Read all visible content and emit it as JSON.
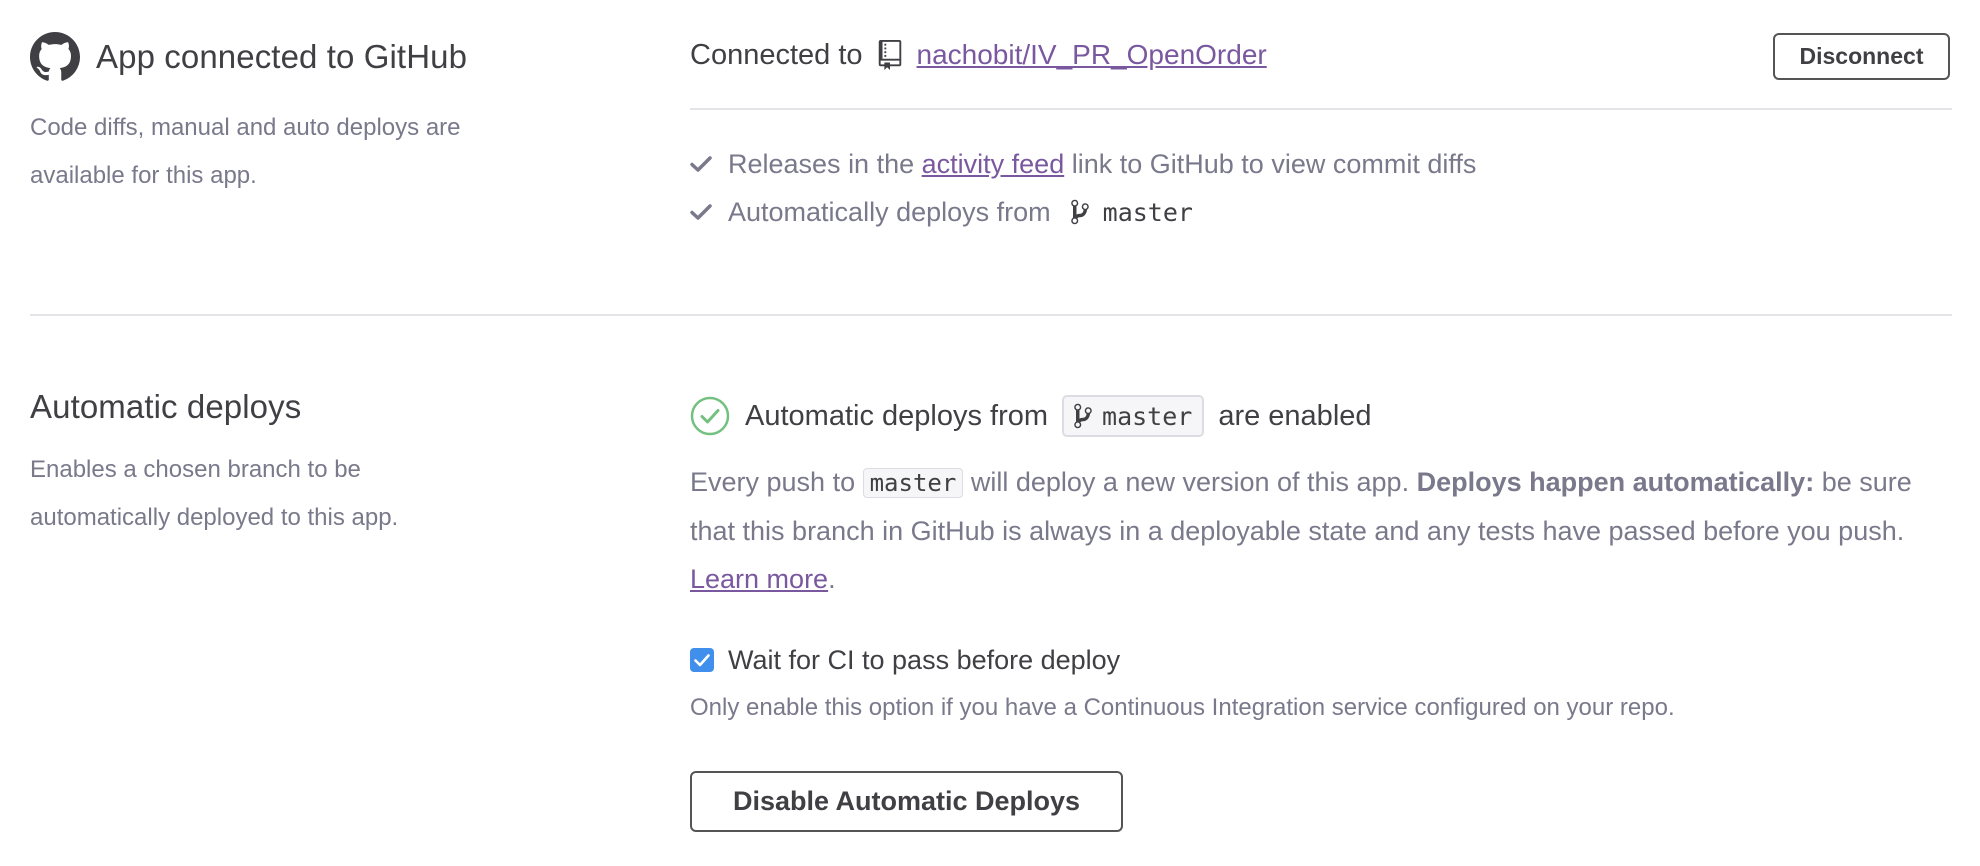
{
  "github": {
    "title": "App connected to GitHub",
    "description": "Code diffs, manual and auto deploys are available for this app.",
    "connected_label": "Connected to",
    "repo_name": "nachobit/IV_PR_OpenOrder",
    "disconnect_label": "Disconnect",
    "features": {
      "releases_prefix": "Releases in the",
      "releases_link": "activity feed",
      "releases_suffix": "link to GitHub to view commit diffs",
      "auto_prefix": "Automatically deploys from",
      "branch": "master"
    },
    "icons": [
      "github-logo-icon",
      "repo-icon",
      "check-icon",
      "branch-icon"
    ]
  },
  "auto_deploys": {
    "title": "Automatic deploys",
    "description": "Enables a chosen branch to be automatically deployed to this app.",
    "status_prefix": "Automatic deploys from",
    "branch": "master",
    "status_suffix": "are enabled",
    "para_prefix": "Every push to",
    "para_code": "master",
    "para_middle": "will deploy a new version of this app.",
    "para_bold": "Deploys happen automatically:",
    "para_rest": "be sure that this branch in GitHub is always in a deployable state and any tests have passed before you push.",
    "learn_more": "Learn more",
    "para_end": ".",
    "ci_label": "Wait for CI to pass before deploy",
    "ci_checked": true,
    "ci_help": "Only enable this option if you have a Continuous Integration service configured on your repo.",
    "disable_label": "Disable Automatic Deploys"
  },
  "colors": {
    "accent_link": "#79589f",
    "text_primary": "#3f3f44",
    "text_muted": "#79798b",
    "success": "#74c080",
    "checkbox": "#408fec"
  }
}
